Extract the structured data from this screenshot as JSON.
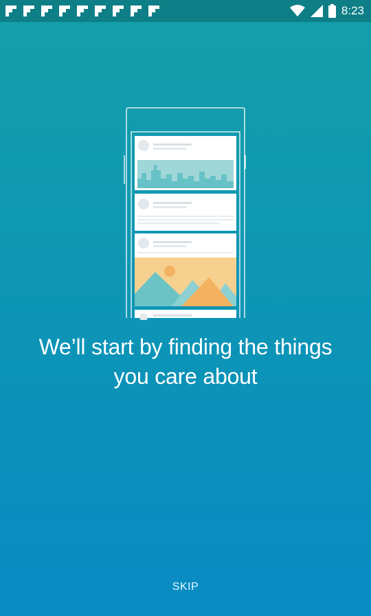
{
  "status_bar": {
    "time": "8:23",
    "notifications": [
      "flipboard-icon",
      "flipboard-icon",
      "flipboard-icon",
      "flipboard-icon",
      "flipboard-icon",
      "flipboard-icon",
      "flipboard-icon",
      "flipboard-icon",
      "flipboard-icon"
    ],
    "icons": [
      "wifi-icon",
      "signal-icon",
      "battery-icon"
    ]
  },
  "onboarding": {
    "headline_line1": "We’ll start by finding the things",
    "headline_line2": "you care about",
    "skip_label": "SKIP"
  },
  "colors": {
    "background_top": "#149fa8",
    "background_bottom": "#0a8bc4",
    "status_bar": "#0e7f86"
  }
}
